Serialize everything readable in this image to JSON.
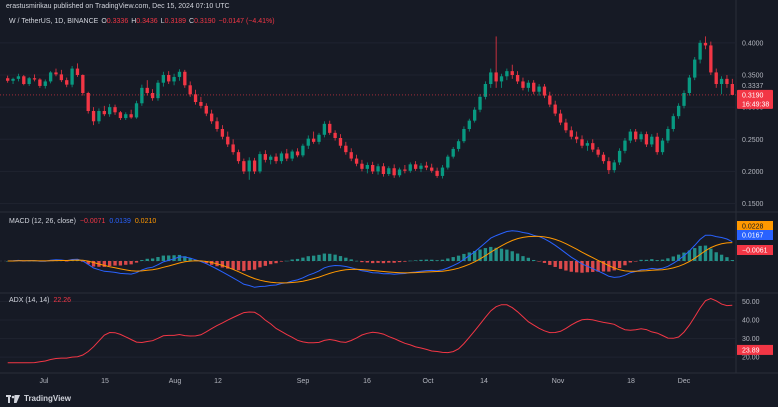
{
  "header": {
    "publisher": "erastusmirikau published on TradingView.com, Dec 15, 2024 07:10 UTC",
    "symbol": "W / TetherUS, 1D, BINANCE",
    "o_label": "O",
    "o": "0.3336",
    "h_label": "H",
    "h": "0.3436",
    "l_label": "L",
    "l": "0.3189",
    "c_label": "C",
    "c": "0.3190",
    "change": "−0.0147 (−4.41%)"
  },
  "macd_label": {
    "name": "MACD (12, 26, close)",
    "v1": "−0.0071",
    "v2": "0.0139",
    "v3": "0.0210"
  },
  "adx_label": {
    "name": "ADX (14, 14)",
    "v": "22.26"
  },
  "price_axis": {
    "ticks": [
      "0.4000",
      "0.3500",
      "0.3000",
      "0.2500",
      "0.2000",
      "0.1500"
    ]
  },
  "price_tags": {
    "prev": "0.3337",
    "last": "0.3190",
    "countdown": "16:49:38"
  },
  "macd_tags": {
    "signal": "0.0228",
    "macd": "0.0167",
    "hist": "−0.0061"
  },
  "adx_axis": {
    "ticks": [
      "50.00",
      "40.00",
      "30.00",
      "20.00"
    ],
    "tag": "23.89"
  },
  "time_axis": {
    "ticks": [
      "Jul",
      "15",
      "Aug",
      "12",
      "Sep",
      "16",
      "Oct",
      "14",
      "Nov",
      "18",
      "Dec"
    ]
  },
  "footer": {
    "brand": "TradingView"
  },
  "colors": {
    "bg": "#161a25",
    "up": "#089981",
    "down": "#f23645",
    "macd": "#2962ff",
    "signal": "#ff9800",
    "adx": "#f23645",
    "hist_up": "#26a69a",
    "hist_down": "#ff5252"
  },
  "chart_data": {
    "type": "candlestick",
    "series": [
      {
        "name": "W / TetherUS",
        "values": [
          [
            0.345,
            0.349,
            0.338,
            0.341
          ],
          [
            0.341,
            0.346,
            0.336,
            0.344
          ],
          [
            0.344,
            0.352,
            0.34,
            0.348
          ],
          [
            0.348,
            0.35,
            0.334,
            0.336
          ],
          [
            0.336,
            0.347,
            0.333,
            0.345
          ],
          [
            0.345,
            0.351,
            0.34,
            0.343
          ],
          [
            0.343,
            0.345,
            0.33,
            0.333
          ],
          [
            0.333,
            0.343,
            0.329,
            0.34
          ],
          [
            0.34,
            0.356,
            0.337,
            0.354
          ],
          [
            0.354,
            0.36,
            0.348,
            0.351
          ],
          [
            0.351,
            0.358,
            0.339,
            0.342
          ],
          [
            0.342,
            0.346,
            0.331,
            0.335
          ],
          [
            0.335,
            0.364,
            0.331,
            0.36
          ],
          [
            0.36,
            0.368,
            0.347,
            0.35
          ],
          [
            0.35,
            0.351,
            0.318,
            0.322
          ],
          [
            0.322,
            0.324,
            0.29,
            0.294
          ],
          [
            0.294,
            0.3,
            0.272,
            0.278
          ],
          [
            0.278,
            0.298,
            0.274,
            0.294
          ],
          [
            0.294,
            0.302,
            0.286,
            0.289
          ],
          [
            0.289,
            0.305,
            0.285,
            0.3
          ],
          [
            0.3,
            0.304,
            0.288,
            0.292
          ],
          [
            0.292,
            0.294,
            0.28,
            0.283
          ],
          [
            0.283,
            0.292,
            0.28,
            0.289
          ],
          [
            0.289,
            0.296,
            0.282,
            0.284
          ],
          [
            0.284,
            0.31,
            0.282,
            0.306
          ],
          [
            0.306,
            0.335,
            0.302,
            0.33
          ],
          [
            0.33,
            0.342,
            0.318,
            0.322
          ],
          [
            0.322,
            0.328,
            0.31,
            0.314
          ],
          [
            0.314,
            0.342,
            0.31,
            0.338
          ],
          [
            0.338,
            0.355,
            0.332,
            0.35
          ],
          [
            0.35,
            0.356,
            0.336,
            0.34
          ],
          [
            0.34,
            0.352,
            0.334,
            0.347
          ],
          [
            0.347,
            0.359,
            0.341,
            0.355
          ],
          [
            0.355,
            0.358,
            0.33,
            0.334
          ],
          [
            0.334,
            0.34,
            0.316,
            0.32
          ],
          [
            0.32,
            0.327,
            0.304,
            0.308
          ],
          [
            0.308,
            0.316,
            0.298,
            0.302
          ],
          [
            0.302,
            0.306,
            0.286,
            0.29
          ],
          [
            0.29,
            0.296,
            0.274,
            0.278
          ],
          [
            0.278,
            0.284,
            0.262,
            0.266
          ],
          [
            0.266,
            0.272,
            0.25,
            0.254
          ],
          [
            0.254,
            0.262,
            0.238,
            0.242
          ],
          [
            0.242,
            0.25,
            0.226,
            0.23
          ],
          [
            0.23,
            0.234,
            0.212,
            0.216
          ],
          [
            0.216,
            0.22,
            0.196,
            0.2
          ],
          [
            0.2,
            0.222,
            0.187,
            0.217
          ],
          [
            0.217,
            0.221,
            0.196,
            0.2
          ],
          [
            0.2,
            0.231,
            0.197,
            0.227
          ],
          [
            0.227,
            0.233,
            0.214,
            0.218
          ],
          [
            0.218,
            0.226,
            0.211,
            0.223
          ],
          [
            0.223,
            0.228,
            0.212,
            0.216
          ],
          [
            0.216,
            0.231,
            0.212,
            0.228
          ],
          [
            0.228,
            0.235,
            0.216,
            0.22
          ],
          [
            0.22,
            0.234,
            0.216,
            0.231
          ],
          [
            0.231,
            0.236,
            0.222,
            0.225
          ],
          [
            0.225,
            0.243,
            0.222,
            0.24
          ],
          [
            0.24,
            0.256,
            0.235,
            0.251
          ],
          [
            0.251,
            0.262,
            0.243,
            0.246
          ],
          [
            0.246,
            0.26,
            0.242,
            0.257
          ],
          [
            0.257,
            0.278,
            0.253,
            0.274
          ],
          [
            0.274,
            0.279,
            0.257,
            0.26
          ],
          [
            0.26,
            0.264,
            0.248,
            0.252
          ],
          [
            0.252,
            0.258,
            0.236,
            0.24
          ],
          [
            0.24,
            0.246,
            0.226,
            0.23
          ],
          [
            0.23,
            0.236,
            0.216,
            0.22
          ],
          [
            0.22,
            0.226,
            0.208,
            0.212
          ],
          [
            0.212,
            0.218,
            0.2,
            0.204
          ],
          [
            0.204,
            0.214,
            0.197,
            0.21
          ],
          [
            0.21,
            0.215,
            0.196,
            0.2
          ],
          [
            0.2,
            0.212,
            0.195,
            0.208
          ],
          [
            0.208,
            0.213,
            0.192,
            0.196
          ],
          [
            0.196,
            0.208,
            0.193,
            0.205
          ],
          [
            0.205,
            0.211,
            0.19,
            0.194
          ],
          [
            0.194,
            0.206,
            0.191,
            0.203
          ],
          [
            0.203,
            0.21,
            0.197,
            0.201
          ],
          [
            0.201,
            0.214,
            0.198,
            0.211
          ],
          [
            0.211,
            0.216,
            0.201,
            0.204
          ],
          [
            0.204,
            0.213,
            0.199,
            0.209
          ],
          [
            0.209,
            0.215,
            0.202,
            0.206
          ],
          [
            0.206,
            0.212,
            0.198,
            0.201
          ],
          [
            0.201,
            0.206,
            0.19,
            0.193
          ],
          [
            0.193,
            0.21,
            0.189,
            0.206
          ],
          [
            0.206,
            0.226,
            0.203,
            0.223
          ],
          [
            0.223,
            0.238,
            0.22,
            0.235
          ],
          [
            0.235,
            0.25,
            0.231,
            0.247
          ],
          [
            0.247,
            0.27,
            0.244,
            0.266
          ],
          [
            0.266,
            0.282,
            0.262,
            0.279
          ],
          [
            0.279,
            0.3,
            0.276,
            0.296
          ],
          [
            0.296,
            0.32,
            0.292,
            0.316
          ],
          [
            0.316,
            0.34,
            0.312,
            0.336
          ],
          [
            0.336,
            0.36,
            0.33,
            0.354
          ],
          [
            0.354,
            0.41,
            0.33,
            0.34
          ],
          [
            0.34,
            0.352,
            0.33,
            0.348
          ],
          [
            0.348,
            0.36,
            0.342,
            0.356
          ],
          [
            0.356,
            0.366,
            0.344,
            0.35
          ],
          [
            0.35,
            0.356,
            0.336,
            0.34
          ],
          [
            0.34,
            0.346,
            0.326,
            0.33
          ],
          [
            0.33,
            0.342,
            0.324,
            0.338
          ],
          [
            0.338,
            0.342,
            0.32,
            0.324
          ],
          [
            0.324,
            0.336,
            0.318,
            0.332
          ],
          [
            0.332,
            0.336,
            0.314,
            0.318
          ],
          [
            0.318,
            0.324,
            0.3,
            0.304
          ],
          [
            0.304,
            0.31,
            0.286,
            0.29
          ],
          [
            0.29,
            0.296,
            0.272,
            0.276
          ],
          [
            0.276,
            0.282,
            0.26,
            0.264
          ],
          [
            0.264,
            0.27,
            0.25,
            0.254
          ],
          [
            0.254,
            0.262,
            0.244,
            0.25
          ],
          [
            0.25,
            0.256,
            0.236,
            0.24
          ],
          [
            0.24,
            0.248,
            0.232,
            0.244
          ],
          [
            0.244,
            0.25,
            0.23,
            0.234
          ],
          [
            0.234,
            0.238,
            0.222,
            0.226
          ],
          [
            0.226,
            0.23,
            0.212,
            0.216
          ],
          [
            0.216,
            0.222,
            0.196,
            0.202
          ],
          [
            0.202,
            0.218,
            0.198,
            0.214
          ],
          [
            0.214,
            0.236,
            0.21,
            0.232
          ],
          [
            0.232,
            0.252,
            0.228,
            0.248
          ],
          [
            0.248,
            0.266,
            0.244,
            0.262
          ],
          [
            0.262,
            0.266,
            0.246,
            0.25
          ],
          [
            0.25,
            0.262,
            0.246,
            0.258
          ],
          [
            0.258,
            0.262,
            0.238,
            0.242
          ],
          [
            0.242,
            0.258,
            0.238,
            0.254
          ],
          [
            0.254,
            0.26,
            0.226,
            0.23
          ],
          [
            0.23,
            0.252,
            0.226,
            0.248
          ],
          [
            0.248,
            0.27,
            0.244,
            0.266
          ],
          [
            0.266,
            0.29,
            0.262,
            0.286
          ],
          [
            0.286,
            0.306,
            0.282,
            0.302
          ],
          [
            0.302,
            0.326,
            0.298,
            0.322
          ],
          [
            0.322,
            0.35,
            0.318,
            0.346
          ],
          [
            0.346,
            0.378,
            0.342,
            0.374
          ],
          [
            0.374,
            0.404,
            0.368,
            0.4
          ],
          [
            0.4,
            0.41,
            0.39,
            0.396
          ],
          [
            0.396,
            0.402,
            0.35,
            0.354
          ],
          [
            0.354,
            0.36,
            0.33,
            0.336
          ],
          [
            0.336,
            0.348,
            0.32,
            0.344
          ],
          [
            0.344,
            0.35,
            0.33,
            0.336
          ],
          [
            0.336,
            0.344,
            0.319,
            0.319
          ]
        ]
      }
    ]
  }
}
